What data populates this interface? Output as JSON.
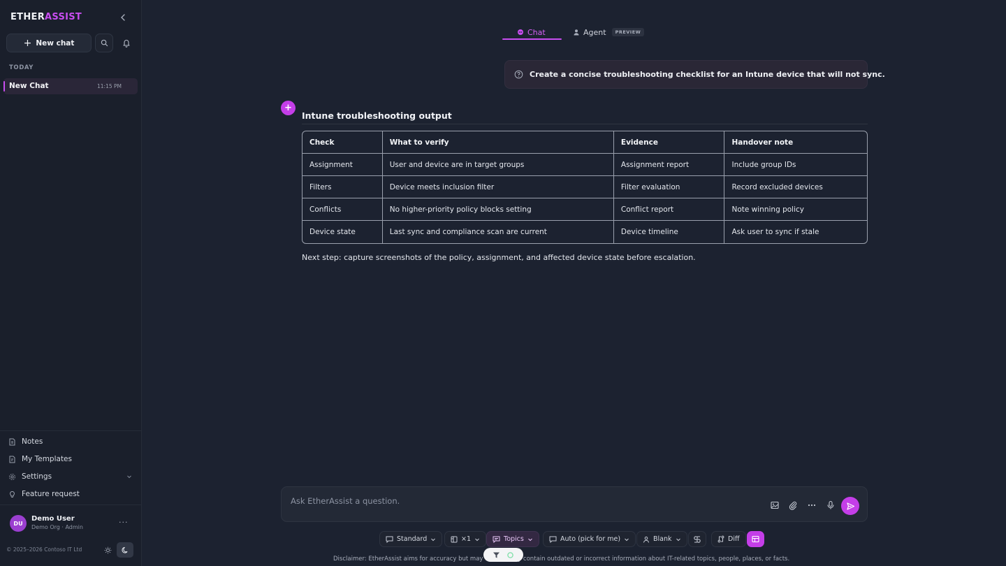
{
  "brand": {
    "part1": "ETHER",
    "part2": "ASSIST"
  },
  "sidebar": {
    "new_chat_label": "New chat",
    "section_label": "TODAY",
    "chats": [
      {
        "title": "New Chat",
        "time": "11:15 PM"
      }
    ],
    "nav": [
      {
        "label": "Notes",
        "icon": "note-icon"
      },
      {
        "label": "My Templates",
        "icon": "template-icon"
      },
      {
        "label": "Settings",
        "icon": "gear-icon"
      },
      {
        "label": "Feature request",
        "icon": "lightbulb-icon"
      }
    ],
    "user": {
      "initials": "DU",
      "name": "Demo User",
      "role": "Demo Org · Admin"
    },
    "copyright": "© 2025–2026 Contoso IT Ltd"
  },
  "tabs": {
    "chat": "Chat",
    "agent": "Agent",
    "agent_badge": "PREVIEW"
  },
  "conversation": {
    "user_message": "Create a concise troubleshooting checklist for an Intune device that will not sync.",
    "ai_badge": "+",
    "output_title": "Intune troubleshooting output",
    "table": {
      "headers": [
        "Check",
        "What to verify",
        "Evidence",
        "Handover note"
      ],
      "rows": [
        [
          "Assignment",
          "User and device are in target groups",
          "Assignment report",
          "Include group IDs"
        ],
        [
          "Filters",
          "Device meets inclusion filter",
          "Filter evaluation",
          "Record excluded devices"
        ],
        [
          "Conflicts",
          "No higher-priority policy blocks setting",
          "Conflict report",
          "Note winning policy"
        ],
        [
          "Device state",
          "Last sync and compliance scan are current",
          "Device timeline",
          "Ask user to sync if stale"
        ]
      ]
    },
    "next_step": "Next step: capture screenshots of the policy, assignment, and affected device state before escalation."
  },
  "composer": {
    "placeholder": "Ask EtherAssist a question.",
    "options": {
      "standard": "Standard",
      "multiplier": "×1",
      "topics": "Topics",
      "auto": "Auto (pick for me)",
      "blank": "Blank",
      "diff": "Diff"
    }
  },
  "disclaimer": "Disclaimer: EtherAssist aims for accuracy but may occasionally contain outdated or incorrect information about IT-related topics, people, places, or facts.",
  "colors": {
    "accent": "#c84df0",
    "background": "#1c2230",
    "sidebar": "#1a1f2b"
  }
}
